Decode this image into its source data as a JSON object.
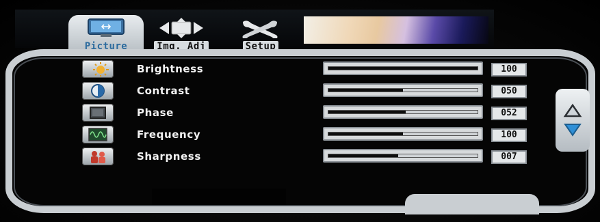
{
  "tabs": [
    {
      "label": "Picture",
      "icon": "monitor-icon",
      "active": true
    },
    {
      "label": "Img. Adj",
      "icon": "arrows-move-icon",
      "active": false
    },
    {
      "label": "Setup",
      "icon": "tools-icon",
      "active": false
    }
  ],
  "rows": [
    {
      "label": "Brightness",
      "icon": "sun-icon",
      "value": "100",
      "level": 1.0
    },
    {
      "label": "Contrast",
      "icon": "contrast-icon",
      "value": "050",
      "level": 0.5
    },
    {
      "label": "Phase",
      "icon": "phase-icon",
      "value": "052",
      "level": 0.52
    },
    {
      "label": "Frequency",
      "icon": "waveform-icon",
      "value": "100",
      "level": 0.5
    },
    {
      "label": "Sharpness",
      "icon": "sharpness-icon",
      "value": "007",
      "level": 0.47
    }
  ],
  "colors": {
    "frame": "#c9ced2",
    "accent_blue": "#2c6b9e",
    "arrow_blue": "#2f8fd6"
  }
}
